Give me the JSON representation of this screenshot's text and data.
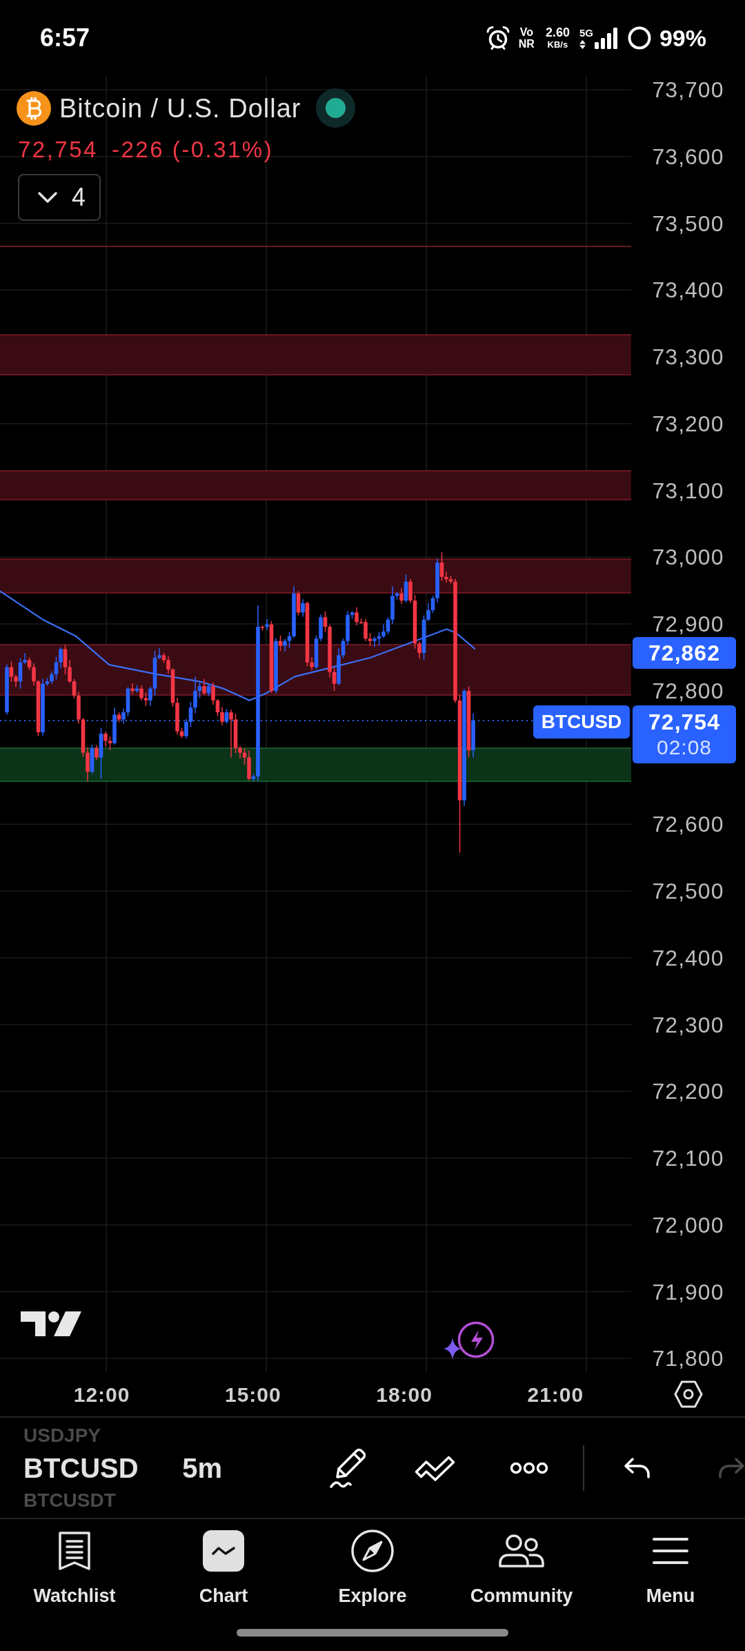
{
  "status_bar": {
    "time": "6:57",
    "network_top": "Vo",
    "network_bottom": "NR",
    "speed": "2.60",
    "speed_unit": "KB/s",
    "network_type": "5G",
    "battery": "99%"
  },
  "header": {
    "title": "Bitcoin / U.S. Dollar",
    "market_open": true,
    "price": "72,754",
    "change": "-226 (-0.31%)",
    "negative": true
  },
  "indicators_toggle": {
    "expanded": false,
    "count": "4"
  },
  "price_axis": {
    "labels_above": [
      "73,700",
      "73,600",
      "73,500",
      "73,400",
      "73,300",
      "73,200",
      "73,100",
      "73,000",
      "72,900",
      "72,800"
    ],
    "labels_below": [
      "72,600",
      "72,500",
      "72,400",
      "72,300",
      "72,200",
      "72,100",
      "72,000",
      "71,900",
      "71,800"
    ]
  },
  "price_tags": [
    {
      "kind": "indicator",
      "value": "72,862"
    },
    {
      "kind": "last_price",
      "symbol": "BTCUSD",
      "value": "72,754",
      "countdown": "02:08"
    }
  ],
  "time_axis": [
    "12:00",
    "15:00",
    "18:00",
    "21:00"
  ],
  "toolbar": {
    "symbols": [
      {
        "label": "USDJPY",
        "selected": false
      },
      {
        "label": "BTCUSD",
        "selected": true
      },
      {
        "label": "BTCUSDT",
        "selected": false
      }
    ],
    "interval": "5m"
  },
  "bottom_nav": [
    {
      "label": "Watchlist",
      "selected": false
    },
    {
      "label": "Chart",
      "selected": true
    },
    {
      "label": "Explore",
      "selected": false
    },
    {
      "label": "Community",
      "selected": false
    },
    {
      "label": "Menu",
      "selected": false
    }
  ]
}
